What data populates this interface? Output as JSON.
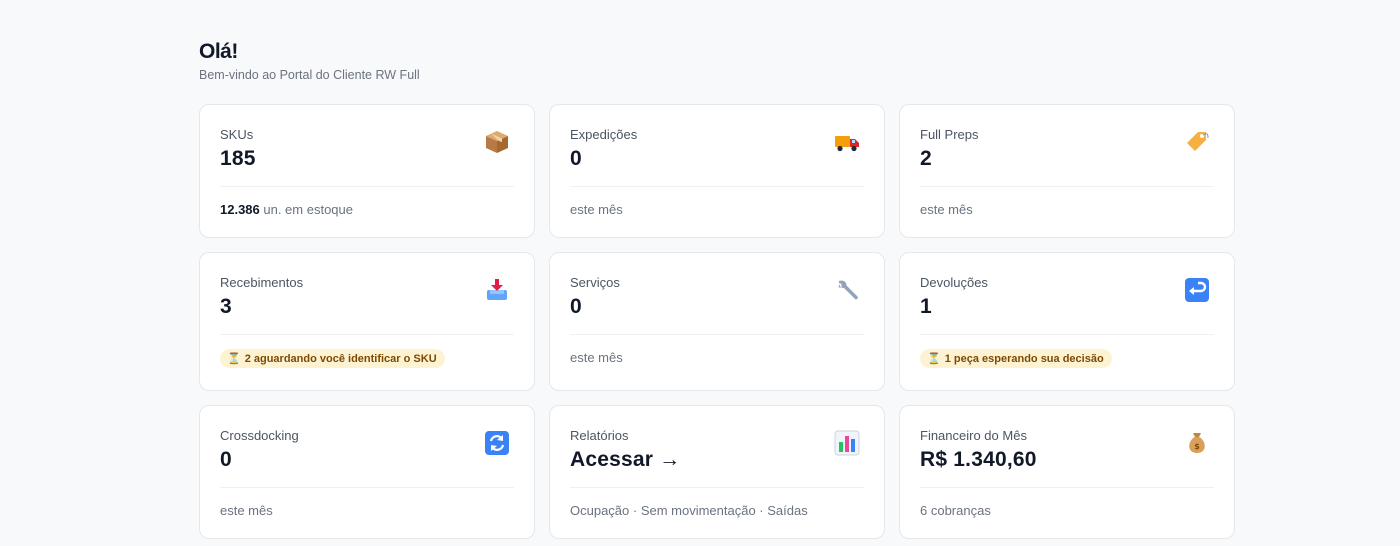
{
  "header": {
    "greeting": "Olá!",
    "subtitle": "Bem-vindo ao Portal do Cliente RW Full"
  },
  "cards": {
    "skus": {
      "label": "SKUs",
      "value": "185",
      "foot_strong": "12.386",
      "foot_text": " un. em estoque",
      "icon": "package-icon"
    },
    "expedicoes": {
      "label": "Expedições",
      "value": "0",
      "foot_text": "este mês",
      "icon": "delivery-truck-icon"
    },
    "fullpreps": {
      "label": "Full Preps",
      "value": "2",
      "foot_text": "este mês",
      "icon": "tag-icon"
    },
    "recebimentos": {
      "label": "Recebimentos",
      "value": "3",
      "badge_text": "2 aguardando você identificar o SKU",
      "icon": "inbox-tray-icon"
    },
    "servicos": {
      "label": "Serviços",
      "value": "0",
      "foot_text": "este mês",
      "icon": "wrench-icon"
    },
    "devolucoes": {
      "label": "Devoluções",
      "value": "1",
      "badge_text": "1 peça esperando sua decisão",
      "icon": "return-arrow-icon"
    },
    "crossdocking": {
      "label": "Crossdocking",
      "value": "0",
      "foot_text": "este mês",
      "icon": "refresh-icon"
    },
    "relatorios": {
      "label": "Relatórios",
      "value": "Acessar →",
      "foot_text": "Ocupação · Sem movimentação · Saídas",
      "icon": "bar-chart-icon"
    },
    "financeiro": {
      "label": "Financeiro do Mês",
      "value": "R$ 1.340,60",
      "foot_text": "6 cobranças",
      "icon": "money-bag-icon"
    }
  },
  "badge_icon": "hourglass-icon",
  "colors": {
    "badge_bg": "#fdf3d3",
    "badge_text": "#7c4a03",
    "background": "#f8f9fb"
  }
}
